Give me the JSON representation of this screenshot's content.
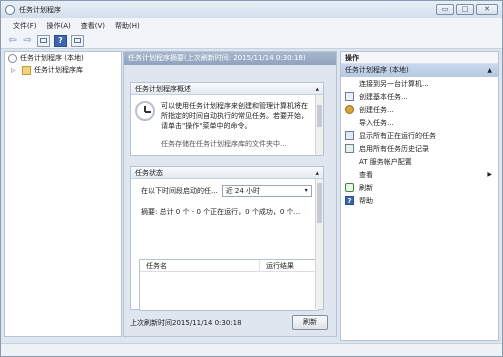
{
  "window": {
    "title": "任务计划程序",
    "controls": {
      "minimize": "▭",
      "maximize": "□",
      "close": "✕"
    }
  },
  "menubar": {
    "items": [
      "文件(F)",
      "操作(A)",
      "查看(V)",
      "帮助(H)"
    ]
  },
  "tree": {
    "root_label": "任务计划程序 (本地)",
    "child_label": "任务计划程序库",
    "toggle": "▷"
  },
  "center": {
    "header": "任务计划程序摘要(上次刷新时间: 2015/11/14 0:30:18)",
    "overview": {
      "title": "任务计划程序概述",
      "text": "可以使用任务计划程序来创建和管理计算机将在所指定的时间自动执行的常见任务。若要开始，请单击\"操作\"菜单中的命令。",
      "more": "任务存储在任务计划程序库的文件夹中..."
    },
    "status": {
      "title": "任务状态",
      "filter_label": "在以下时间段启动的任...",
      "filter_value": "近 24 小时",
      "summary": "摘要: 总计 0 个 - 0 个正在运行，0 个成功，0 个...",
      "columns": [
        "任务名",
        "运行结果"
      ]
    },
    "footer": {
      "last_refresh": "上次刷新时间2015/11/14 0:30:18",
      "refresh_button": "刷新"
    },
    "collapse_glyph": "▴"
  },
  "actions": {
    "header": "操作",
    "group_label": "任务计划程序 (本地)",
    "group_caret": "▲",
    "items": [
      {
        "label": "连接到另一台计算机...",
        "icon": "blank"
      },
      {
        "label": "创建基本任务...",
        "icon": "task-icon"
      },
      {
        "label": "创建任务...",
        "icon": "gear-icon"
      },
      {
        "label": "导入任务...",
        "icon": "blank"
      },
      {
        "label": "显示所有正在运行的任务",
        "icon": "running-tasks-icon"
      },
      {
        "label": "启用所有任务历史记录",
        "icon": "history-icon"
      },
      {
        "label": "AT 服务帐户配置",
        "icon": "blank"
      },
      {
        "label": "查看",
        "icon": "blank",
        "submenu": "▶"
      },
      {
        "label": "刷新",
        "icon": "refresh-icon"
      },
      {
        "label": "帮助",
        "icon": "help-icon"
      }
    ]
  },
  "toolbar": {
    "back": "⇦",
    "forward": "⇨",
    "help_glyph": "?"
  }
}
